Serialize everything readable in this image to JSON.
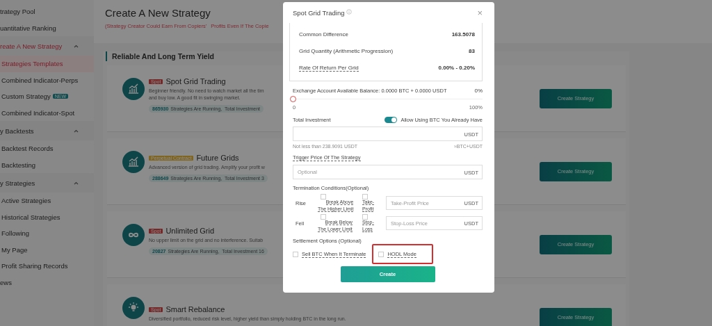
{
  "sidebar": {
    "items": [
      {
        "label": "trategy Pool",
        "selected": false
      },
      {
        "label": "uantitative Ranking",
        "selected": false
      },
      {
        "label": "reate A New Strategy",
        "expanded": true,
        "selected": true,
        "children": [
          {
            "label": "Strategies Templates",
            "selected": true
          },
          {
            "label": "Combined Indicator-Perps",
            "selected": false
          },
          {
            "label": "Custom Strategy",
            "selected": false,
            "badge": "NEW"
          },
          {
            "label": "Combined Indicator-Spot",
            "selected": false
          }
        ]
      },
      {
        "label": "y Backtests",
        "expanded": true,
        "selected": false,
        "children": [
          {
            "label": "Backtest Records",
            "selected": false
          },
          {
            "label": "Backtesting",
            "selected": false
          }
        ]
      },
      {
        "label": "y Strategies",
        "expanded": true,
        "selected": false,
        "children": [
          {
            "label": "Active Strategies",
            "selected": false
          },
          {
            "label": "Historical Strategies",
            "selected": false
          },
          {
            "label": "Following",
            "selected": false
          },
          {
            "label": "My Page",
            "selected": false
          },
          {
            "label": "Profit Sharing Records",
            "selected": false
          }
        ]
      },
      {
        "label": "ews",
        "selected": false
      }
    ]
  },
  "header": {
    "title": "Create A New Strategy",
    "subtitle": "(Strategy Creator Could Earn From Copiers'   Profits Even If The Copie"
  },
  "section": {
    "title": "Reliable And Long Term Yield",
    "cards": [
      {
        "tag": "Spot",
        "title": "Spot Grid Trading",
        "description": [
          "Beginner friendly. No need to watch market all the tim",
          "and buy low. A good fit in swinging market."
        ],
        "running": "865930",
        "stats": "Strategies Are Running,  Total Investment",
        "button": "Create Strategy"
      },
      {
        "tag": "Perpetual Contract",
        "title": "Future Grids",
        "description": [
          "Advanced version of grid trading. Amplify your profit w"
        ],
        "running": "288649",
        "stats": "Strategies Are Running,  Total Investment 3",
        "button": "Create Strategy"
      },
      {
        "tag": "Spot",
        "title": "Unlimited Grid",
        "description": [
          "No upper limit on the grid and no interference. Suitab"
        ],
        "running": "20827",
        "stats": "Strategies Are Running,  Total Investment 16",
        "button": "Create Strategy"
      },
      {
        "tag": "Spot",
        "title": "Smart Rebalance",
        "description": [
          "Diversified portfolio, reduced risk level, higher yield than simply holding BTC in the long run."
        ],
        "button": "Create Strategy"
      }
    ]
  },
  "modal": {
    "title": "Spot Grid Trading",
    "close": "×",
    "summary": [
      {
        "label": "Common Difference",
        "value": "163.5078",
        "dashed": false
      },
      {
        "label": "Grid Quantity (Arithmetic Progression)",
        "value": "83",
        "dashed": false
      },
      {
        "label": "Rate Of Return Per Grid",
        "value": "0.00% - 0.20%",
        "dashed": true
      }
    ],
    "balance": {
      "label": "Exchange Account Available Balance: 0.0000 BTC + 0.0000 USDT",
      "percent": "0%",
      "level": 0,
      "min": "0",
      "max": "100%"
    },
    "investment": {
      "label": "Total Investment",
      "toggle_label": "Allow Using BTC You Already Have",
      "on": true,
      "unit": "USDT",
      "hint": "Not less than 238.9091 USDT",
      "approx": "≈BTC+USDT"
    },
    "trigger": {
      "label": "Trigger Price Of The Strategy",
      "placeholder": "Optional",
      "unit": "USDT"
    },
    "termination": {
      "label": "Termination Conditions(Optional)",
      "rows": [
        {
          "label": "Rise",
          "break_label": [
            "Break Above",
            "The Higher Limit"
          ],
          "break_checked": false,
          "stop_label": [
            "Take-",
            "Profit"
          ],
          "stop_checked": false,
          "placeholder": "Take-Profit Price",
          "unit": "USDT"
        },
        {
          "label": "Fell",
          "break_label": [
            "Break Below",
            "The Lower Limit"
          ],
          "break_checked": false,
          "stop_label": [
            "Stop-",
            "Loss"
          ],
          "stop_checked": false,
          "placeholder": "Stop-Loss Price",
          "unit": "USDT"
        }
      ]
    },
    "settlement": {
      "label": "Settlement Options  (Optional)",
      "options": [
        {
          "label": "Sell BTC When It Terminate",
          "checked": false,
          "highlighted": false
        },
        {
          "label": "HODL Mode",
          "checked": false,
          "highlighted": true
        }
      ]
    },
    "submit": "Create"
  }
}
